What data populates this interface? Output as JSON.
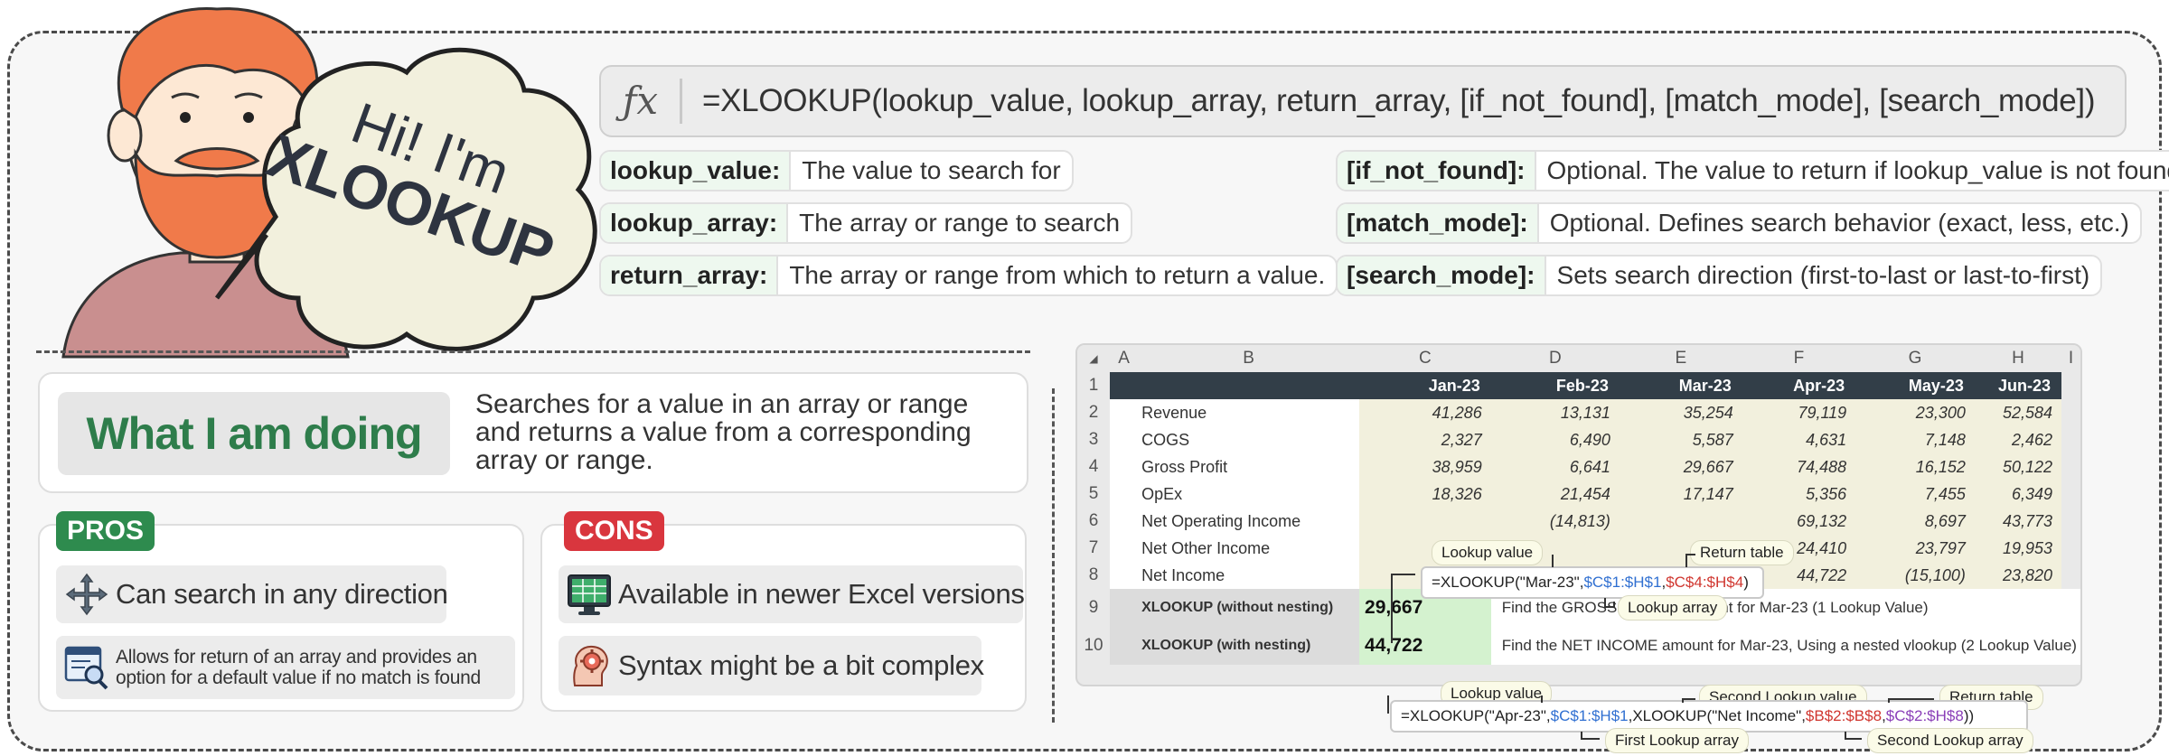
{
  "character": {
    "greeting": "Hi! I'm",
    "name": "XLOOKUP"
  },
  "formula_bar": {
    "icon": "fx-icon",
    "formula": "=XLOOKUP(lookup_value, lookup_array, return_array, [if_not_found], [match_mode], [search_mode])"
  },
  "params_left": [
    {
      "key": "lookup_value:",
      "desc": "The value to search for"
    },
    {
      "key": "lookup_array:",
      "desc": "The array or range to search"
    },
    {
      "key": "return_array:",
      "desc": "The array or range from which to return a value."
    }
  ],
  "params_right": [
    {
      "key": "[if_not_found]:",
      "desc": "Optional. The value to return if lookup_value is not found."
    },
    {
      "key": "[match_mode]:",
      "desc": "Optional. Defines search behavior (exact, less, etc.)"
    },
    {
      "key": "[search_mode]:",
      "desc": "Sets search direction (first-to-last or last-to-first)"
    }
  ],
  "doing": {
    "title": "What I am doing",
    "description": "Searches for a value in an array or range and returns a value from a corresponding array or range."
  },
  "pros": {
    "tag": "PROS",
    "color": "#2e8b4e",
    "items": [
      {
        "icon": "move-arrows-icon",
        "text": "Can search in any direction"
      },
      {
        "icon": "window-magnifier-icon",
        "text": "Allows for return of an array and provides an option for a default value if no match is found"
      }
    ]
  },
  "cons": {
    "tag": "CONS",
    "color": "#d9363e",
    "items": [
      {
        "icon": "spreadsheet-monitor-icon",
        "text": "Available in newer Excel versions"
      },
      {
        "icon": "brain-gear-icon",
        "text": "Syntax might be a bit complex"
      }
    ]
  },
  "sheet": {
    "columns": [
      "A",
      "B",
      "C",
      "D",
      "E",
      "F",
      "G",
      "H",
      "I"
    ],
    "months": [
      "Jan-23",
      "Feb-23",
      "Mar-23",
      "Apr-23",
      "May-23",
      "Jun-23"
    ],
    "rows": [
      {
        "n": "2",
        "label": "Revenue",
        "values": [
          "41,286",
          "13,131",
          "35,254",
          "79,119",
          "23,300",
          "52,584"
        ]
      },
      {
        "n": "3",
        "label": "COGS",
        "values": [
          "2,327",
          "6,490",
          "5,587",
          "4,631",
          "7,148",
          "2,462"
        ]
      },
      {
        "n": "4",
        "label": "Gross Profit",
        "values": [
          "38,959",
          "6,641",
          "29,667",
          "74,488",
          "16,152",
          "50,122"
        ]
      },
      {
        "n": "5",
        "label": "OpEx",
        "values": [
          "18,326",
          "21,454",
          "17,147",
          "5,356",
          "7,455",
          "6,349"
        ]
      },
      {
        "n": "6",
        "label": "Net Operating Income",
        "values": [
          "",
          "(14,813)",
          "",
          "69,132",
          "8,697",
          "43,773"
        ]
      },
      {
        "n": "7",
        "label": "Net Other Income",
        "values": [
          "",
          "",
          "",
          "24,410",
          "23,797",
          "19,953"
        ]
      },
      {
        "n": "8",
        "label": "Net Income",
        "values": [
          "",
          "",
          "",
          "44,722",
          "(15,100)",
          "23,820"
        ]
      }
    ],
    "row1": "1",
    "row9": {
      "n": "9",
      "label": "XLOOKUP (without nesting)",
      "result": "29,667",
      "note": "Find the GROSS PROFIT amount for Mar-23 (1 Lookup Value)"
    },
    "row10": {
      "n": "10",
      "label": "XLOOKUP (with nesting)",
      "result": "44,722",
      "note": "Find the NET INCOME amount for Mar-23, Using a nested vlookup  (2 Lookup Value)"
    }
  },
  "callout1": {
    "formula_parts": [
      "=XLOOKUP(\"Mar-23\",",
      "$C$1:$H$1",
      ",",
      "$C$4:$H$4",
      ")"
    ],
    "lookup_value": "Lookup value",
    "return_table": "Return table",
    "lookup_array": "Lookup array"
  },
  "callout2": {
    "formula_parts": [
      "=XLOOKUP(\"Apr-23\",",
      "$C$1:$H$1",
      ",XLOOKUP(\"Net Income\",",
      "$B$2:$B$8",
      ",",
      "$C$2:$H$8",
      "))"
    ],
    "lookup_value": "Lookup value",
    "second_lookup_value": "Second Lookup value",
    "return_table": "Return table",
    "first_lookup_array": "First Lookup array",
    "second_lookup_array": "Second Lookup array"
  }
}
